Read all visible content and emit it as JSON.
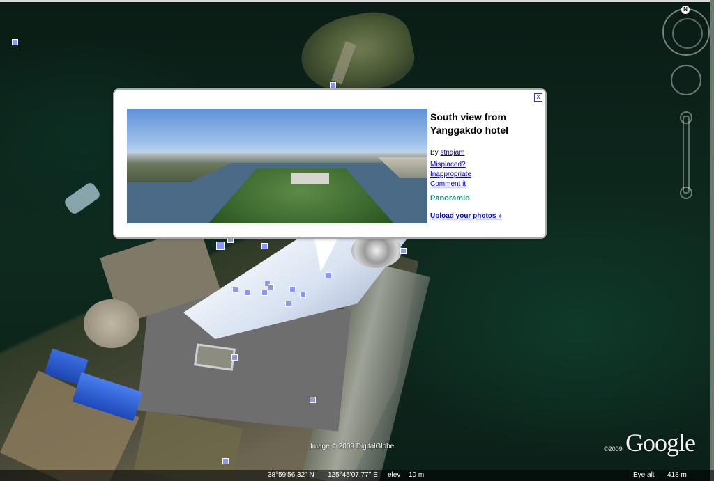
{
  "balloon": {
    "title": "South view from Yanggakdo hotel",
    "by_prefix": "By",
    "author": "stnqiam",
    "links": {
      "misplaced": "Misplaced?",
      "inappropriate": "Inappropriate",
      "comment": "Comment it"
    },
    "brand": "Panoramio",
    "upload": "Upload your photos »",
    "close": "x"
  },
  "compass": {
    "north": "N"
  },
  "credits": {
    "imagery": "Image © 2009 DigitalGlobe",
    "year": "©2009",
    "logo": "Google"
  },
  "status": {
    "lat": "38°59'56.32\" N",
    "lon": "125°45'07.77\" E",
    "elev_label": "elev",
    "elev_value": "10 m",
    "eye_alt_label": "Eye alt",
    "eye_alt_value": "418 m"
  },
  "colors": {
    "marker": "#8a97ff",
    "link": "#0000cc",
    "panoramio": "#0f8f6f"
  }
}
